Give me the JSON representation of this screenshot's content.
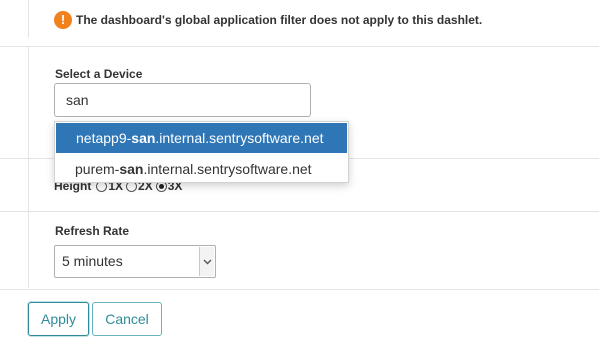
{
  "notice": {
    "icon": "exclamation-icon",
    "text": "The dashboard's global application filter does not apply to this dashlet."
  },
  "device": {
    "label": "Select a Device",
    "value": "san",
    "suggestions": [
      {
        "before": "netapp9-",
        "match": "san",
        "after": ".internal.sentrysoftware.net",
        "selected": true
      },
      {
        "before": "purem-",
        "match": "san",
        "after": ".internal.sentrysoftware.net",
        "selected": false
      }
    ]
  },
  "height": {
    "label": "Height",
    "options": [
      {
        "label": "1X",
        "checked": false
      },
      {
        "label": "2X",
        "checked": false
      },
      {
        "label": "3X",
        "checked": true
      }
    ]
  },
  "refresh": {
    "label": "Refresh Rate",
    "selected": "5 minutes"
  },
  "actions": {
    "apply": "Apply",
    "cancel": "Cancel"
  },
  "colors": {
    "accent": "#2e8c9a",
    "selection": "#2f76b6",
    "warning": "#f0811c"
  }
}
